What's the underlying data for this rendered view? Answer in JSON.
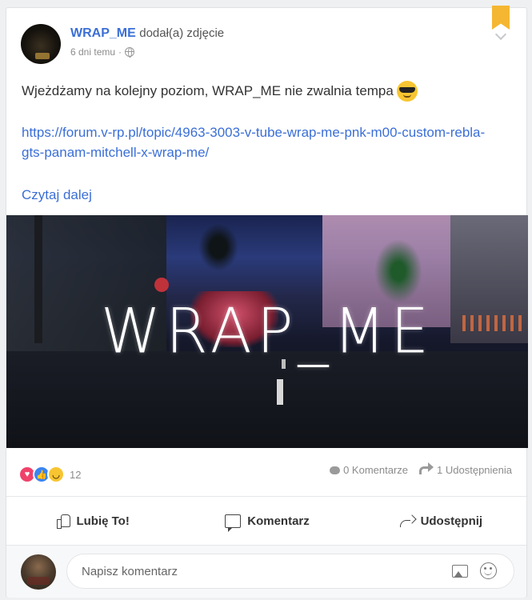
{
  "post": {
    "author": "WRAP_ME",
    "action": "dodał(a) zdjęcie",
    "time": "6 dni temu",
    "separator": "·",
    "text": "Wjeżdżamy na kolejny poziom, WRAP_ME nie zwalnia tempa",
    "link": "https://forum.v-rp.pl/topic/4963-3003-v-tube-wrap-me-pnk-m00-custom-rebla-gts-panam-mitchell-x-wrap-me/",
    "read_more": "Czytaj dalej",
    "image_title": "WRAP_ME"
  },
  "icons": {
    "bookmark": "bookmark-icon",
    "chevron": "chevron-down-icon",
    "privacy": "globe-icon",
    "emoji": "sunglasses-emoji"
  },
  "reactions": {
    "types": [
      "love",
      "like",
      "haha"
    ],
    "count": "12"
  },
  "stats": {
    "comments": "0 Komentarze",
    "shares": "1 Udostępnienia"
  },
  "actions": {
    "like": "Lubię To!",
    "comment": "Komentarz",
    "share": "Udostępnij"
  },
  "comment_box": {
    "placeholder": "Napisz komentarz"
  },
  "colors": {
    "accent": "#3b6fd6",
    "bookmark": "#f5b731",
    "love": "#f0416a",
    "like": "#3b84f0",
    "haha": "#f7c531"
  }
}
